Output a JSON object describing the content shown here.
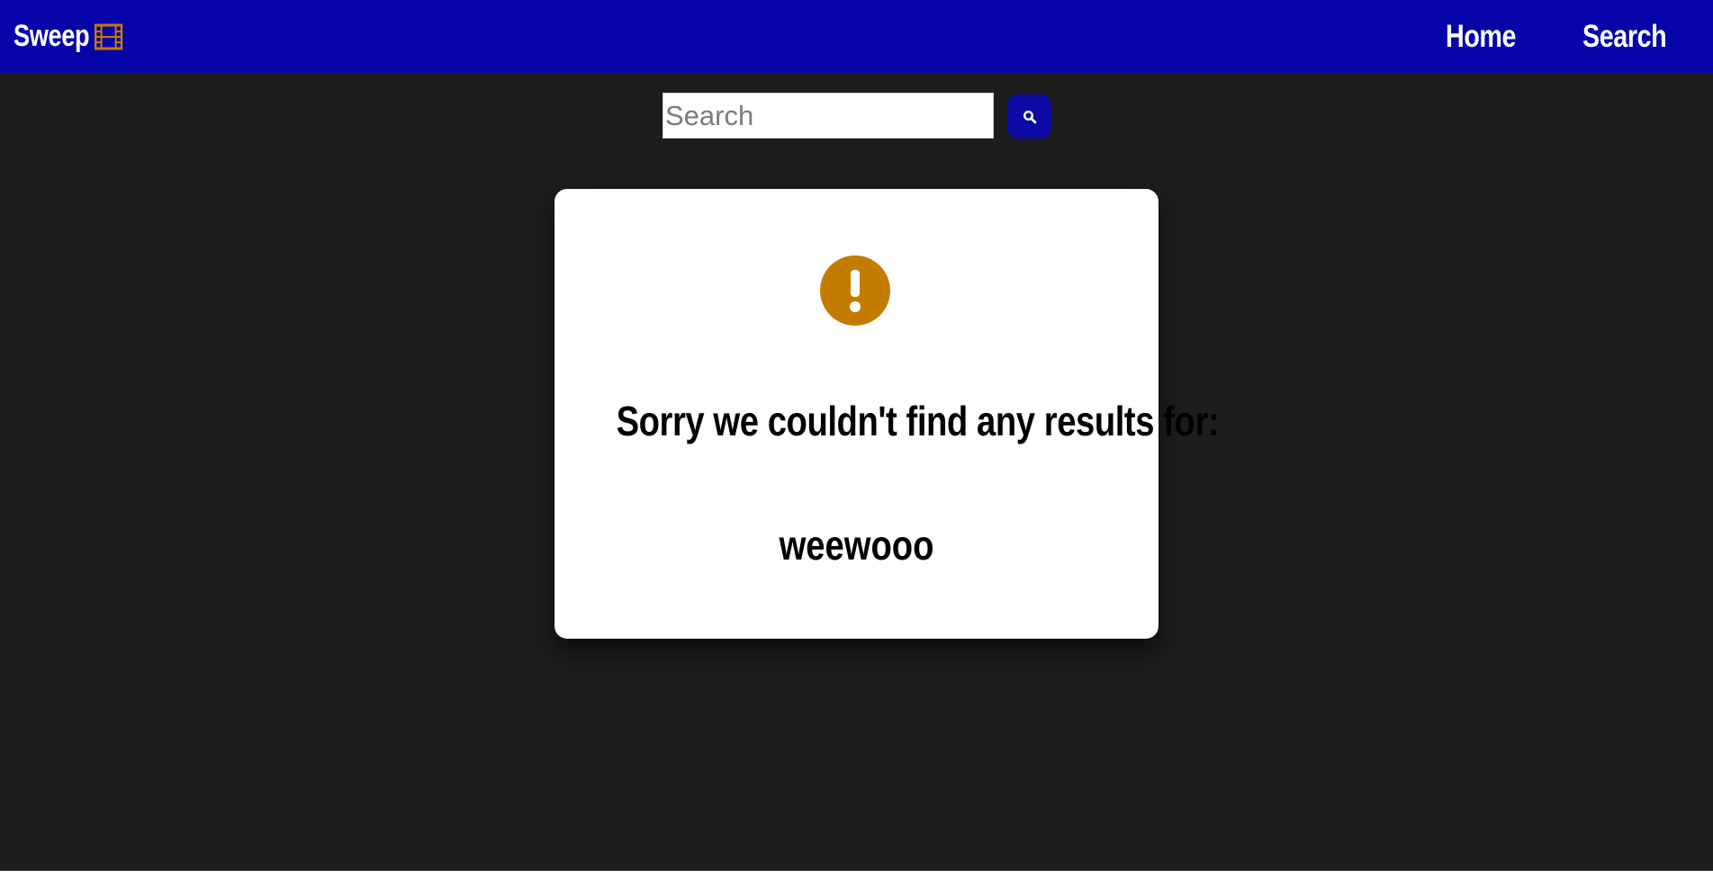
{
  "navbar": {
    "brand": "Sweep",
    "brand_icon": "film-icon",
    "links": [
      {
        "label": "Home"
      },
      {
        "label": "Search"
      }
    ],
    "background_color": "#0404a8"
  },
  "search": {
    "placeholder": "Search",
    "value": "",
    "button_icon": "search-icon",
    "button_color": "#0b0ba3"
  },
  "result_card": {
    "icon": "exclamation-circle-icon",
    "icon_color": "#c47c00",
    "message": "Sorry we couldn't find any results for:",
    "query": "weewooo"
  },
  "colors": {
    "page_background": "#1d1d1d",
    "card_background": "#ffffff",
    "accent": "#c47c00"
  }
}
